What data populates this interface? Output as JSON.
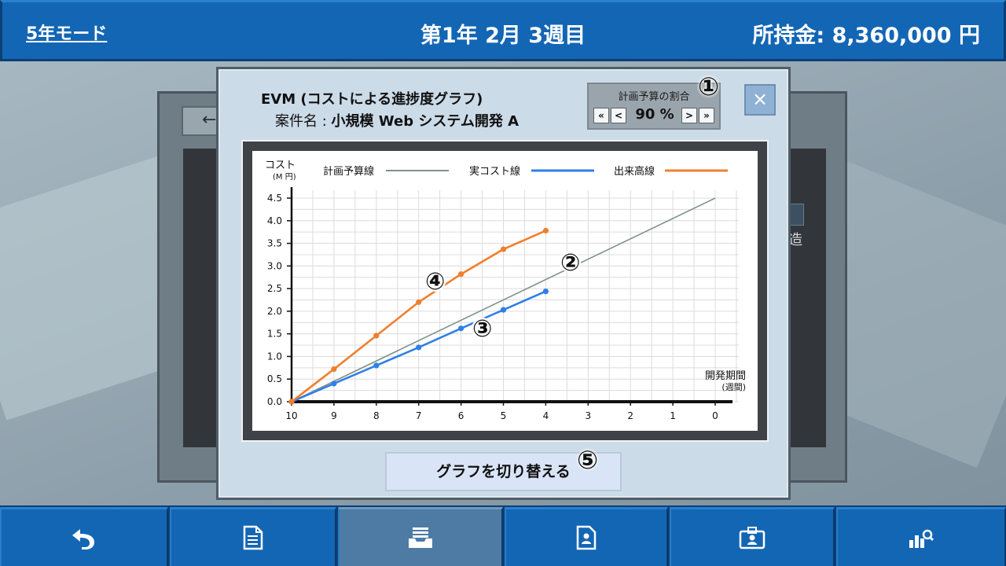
{
  "header": {
    "mode": "5年モード",
    "date": "第1年 2月 3週目",
    "money": "所持金: 8,360,000 円"
  },
  "background_dialog": {
    "back_arrow": "←",
    "side_text": "造"
  },
  "dialog": {
    "title": "EVM (コストによる進捗度グラフ)",
    "project_label": "案件名 :",
    "project_name": "小規模 Web システム開発 A",
    "ratio": {
      "label": "計画予算の割合",
      "value": "90 %",
      "first_btn": "«",
      "prev_btn": "<",
      "next_btn": ">",
      "last_btn": "»"
    },
    "close": "×",
    "switch_button": "グラフを切り替える",
    "markers": {
      "m1": "①",
      "m2": "②",
      "m3": "③",
      "m4": "④",
      "m5": "⑤"
    }
  },
  "chart_data": {
    "type": "line",
    "ylabel": "コスト",
    "yunit": "(M 円)",
    "xlabel": "開発期間",
    "xunit": "(週間)",
    "x_ticks": [
      "10",
      "9",
      "8",
      "7",
      "6",
      "5",
      "4",
      "3",
      "2",
      "1",
      "0"
    ],
    "y_ticks": [
      "0.0",
      "0.5",
      "1.0",
      "1.5",
      "2.0",
      "2.5",
      "3.0",
      "3.5",
      "4.0",
      "4.5"
    ],
    "xlim": [
      10,
      0
    ],
    "ylim": [
      0,
      4.5
    ],
    "grid": true,
    "legend_position": "top",
    "series": [
      {
        "name": "計画予算線",
        "color": "#7f928a",
        "marker": false,
        "x": [
          10,
          0
        ],
        "y": [
          0,
          4.5
        ]
      },
      {
        "name": "実コスト線",
        "color": "#2f7fe8",
        "marker": true,
        "x": [
          10,
          9,
          8,
          7,
          6,
          5,
          4
        ],
        "y": [
          0,
          0.4,
          0.8,
          1.2,
          1.62,
          2.03,
          2.44
        ]
      },
      {
        "name": "出来高線",
        "color": "#f07f2e",
        "marker": true,
        "x": [
          10,
          9,
          8,
          7,
          6,
          5,
          4
        ],
        "y": [
          0,
          0.72,
          1.46,
          2.2,
          2.82,
          3.37,
          3.78
        ]
      }
    ]
  },
  "toolbar": {
    "buttons": [
      {
        "name": "back-button",
        "icon": "undo-arrow-icon"
      },
      {
        "name": "document-button",
        "icon": "document-icon"
      },
      {
        "name": "inbox-button",
        "icon": "inbox-tray-icon"
      },
      {
        "name": "employee-doc-button",
        "icon": "person-document-icon"
      },
      {
        "name": "id-badge-button",
        "icon": "id-badge-icon"
      },
      {
        "name": "analytics-button",
        "icon": "chart-search-icon"
      }
    ],
    "active_index": 2
  }
}
